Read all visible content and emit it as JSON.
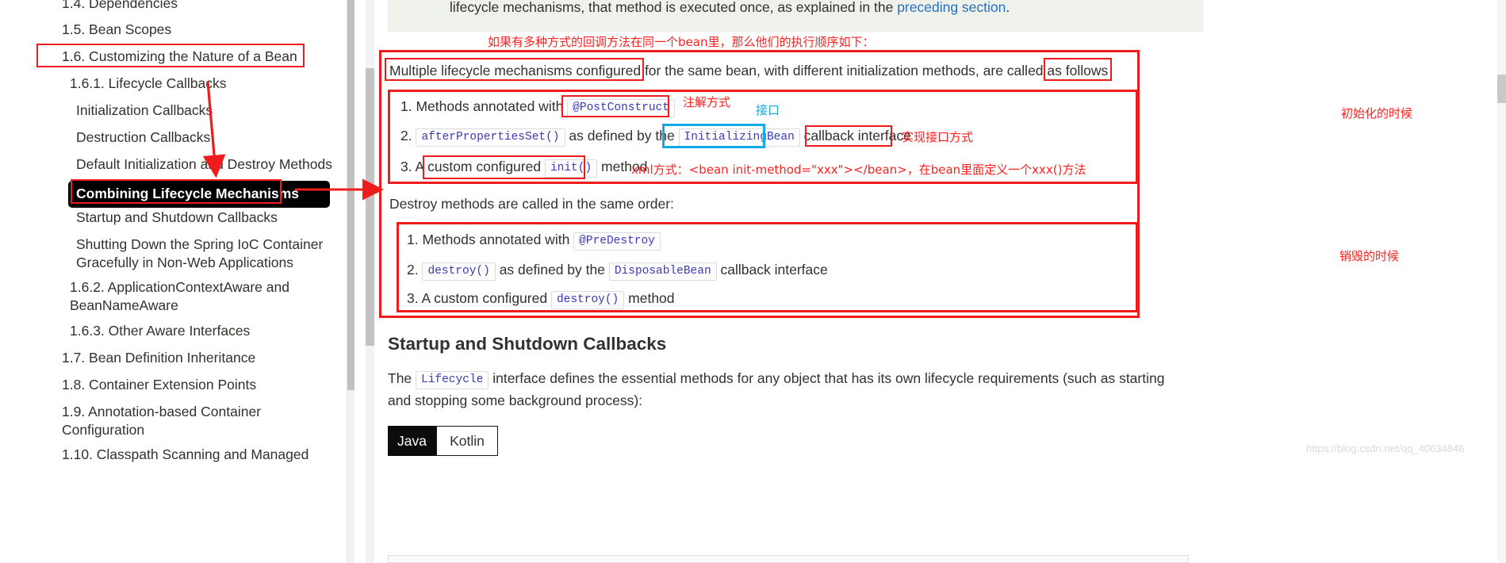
{
  "sidebar": {
    "items": [
      {
        "label": "1.4. Dependencies",
        "level": 1,
        "active": false
      },
      {
        "label": "1.5. Bean Scopes",
        "level": 1,
        "active": false
      },
      {
        "label": "1.6. Customizing the Nature of a Bean",
        "level": 1,
        "active": false,
        "highlight": "red-box"
      },
      {
        "label": "1.6.1. Lifecycle Callbacks",
        "level": 2,
        "active": false
      },
      {
        "label": "Initialization Callbacks",
        "level": 3,
        "active": false
      },
      {
        "label": "Destruction Callbacks",
        "level": 3,
        "active": false
      },
      {
        "label": "Default Initialization and Destroy Methods",
        "level": 3,
        "active": false
      },
      {
        "label": "Combining Lifecycle Mechanisms",
        "level": 3,
        "active": true
      },
      {
        "label": "Startup and Shutdown Callbacks",
        "level": 3,
        "active": false
      },
      {
        "label": "Shutting Down the Spring IoC Container Gracefully in Non-Web Applications",
        "level": 3,
        "active": false
      },
      {
        "label": "1.6.2. ApplicationContextAware and BeanNameAware",
        "level": 2,
        "active": false
      },
      {
        "label": "1.6.3. Other Aware Interfaces",
        "level": 2,
        "active": false
      },
      {
        "label": "1.7. Bean Definition Inheritance",
        "level": 1,
        "active": false
      },
      {
        "label": "1.8. Container Extension Points",
        "level": 1,
        "active": false
      },
      {
        "label": "1.9. Annotation-based Container Configuration",
        "level": 1,
        "active": false
      },
      {
        "label": "1.10. Classpath Scanning and Managed",
        "level": 1,
        "active": false
      }
    ]
  },
  "content": {
    "quote": {
      "text_before": "lifecycle mechanisms, that method is executed once, as explained in the ",
      "link_text": "preceding section",
      "text_after": "."
    },
    "annotations": {
      "top_order_note": "如果有多种方式的回调方法在同一个bean里，那么他们的执行顺序如下：",
      "annotation_way": "注解方式",
      "interface_way_label": "接口",
      "implement_interface_way": "实现接口方式",
      "xml_way": "xml方式：<bean init-method=\"xxx\"></bean>，在bean里面定义一个xxx()方法",
      "init_phase": "初始化的时候",
      "destroy_phase": "销毁的时候"
    },
    "intro_paragraph": {
      "seg1": "Multiple lifecycle mechanisms configured",
      "seg2": " for the same bean, with different initialization methods, are called ",
      "seg3": "as follows"
    },
    "init_list": [
      {
        "num": "1.",
        "pre": "Methods annotated with ",
        "code": "@PostConstruct",
        "post": ""
      },
      {
        "num": "2.",
        "pre": "",
        "code": "afterPropertiesSet()",
        "mid": " as defined by the ",
        "code2": "InitializingBean",
        "post": " callback interface"
      },
      {
        "num": "3.",
        "pre": "A ",
        "boxed": "custom configured ",
        "code": "init()",
        "post": " method"
      }
    ],
    "destroy_intro": "Destroy methods are called in the same order:",
    "destroy_list": [
      {
        "num": "1.",
        "pre": "Methods annotated with ",
        "code": "@PreDestroy",
        "post": ""
      },
      {
        "num": "2.",
        "pre": "",
        "code": "destroy()",
        "mid": " as defined by the ",
        "code2": "DisposableBean",
        "post": " callback interface"
      },
      {
        "num": "3.",
        "pre": "A custom configured ",
        "code": "destroy()",
        "post": " method"
      }
    ],
    "section_heading": "Startup and Shutdown Callbacks",
    "lifecycle_paragraph": {
      "seg1": "The ",
      "code": "Lifecycle",
      "seg2": " interface defines the essential methods for any object that has its own lifecycle requirements (such as starting and stopping some background process):"
    },
    "tabs": [
      {
        "label": "Java",
        "active": true
      },
      {
        "label": "Kotlin",
        "active": false
      }
    ],
    "watermark": "https://blog.csdn.net/qq_40634846"
  },
  "colors": {
    "annotation_red": "#ee1c1c",
    "annotation_cyan": "#14a9e8",
    "link_blue": "#2a6ebb",
    "code_blue": "#3b3bb5",
    "active_bg": "#000000",
    "quote_bg": "#eef2ea"
  }
}
